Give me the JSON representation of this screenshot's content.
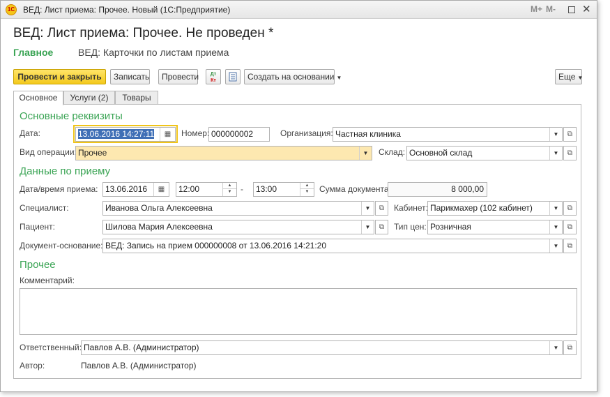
{
  "window": {
    "title": "ВЕД: Лист приема: Прочее. Новый  (1С:Предприятие)",
    "icon": "1c-icon",
    "controls": {
      "mplus": "M+",
      "mminus": "M-",
      "maximize": "maximize-icon",
      "close": "✕"
    }
  },
  "header": {
    "title": "ВЕД: Лист приема: Прочее. Не проведен *",
    "nav_main": "Главное",
    "nav_link": "ВЕД: Карточки по листам приема"
  },
  "toolbar": {
    "post_close": "Провести и закрыть",
    "save": "Записать",
    "post": "Провести",
    "dtkt_icon": "Дт Кт",
    "doc_icon": "document-icon",
    "create_based": "Создать на основании",
    "more": "Еще"
  },
  "tabs": [
    {
      "label": "Основное",
      "active": true
    },
    {
      "label": "Услуги (2)",
      "active": false
    },
    {
      "label": "Товары",
      "active": false
    }
  ],
  "main_req": {
    "section": "Основные реквизиты",
    "date_label": "Дата:",
    "date_value": "13.06.2016 14:27:11",
    "number_label": "Номер:",
    "number_value": "000000002",
    "org_label": "Организация:",
    "org_value": "Частная клиника",
    "op_label": "Вид операции:",
    "op_value": "Прочее",
    "stock_label": "Склад:",
    "stock_value": "Основной склад"
  },
  "reception": {
    "section": "Данные по приему",
    "dt_label": "Дата/время приема:",
    "date": "13.06.2016",
    "time_from": "12:00",
    "dash": "-",
    "time_to": "13:00",
    "sum_label": "Сумма документа:",
    "sum_value": "8 000,00",
    "spec_label": "Специалист:",
    "spec_value": "Иванова Ольга Алексеевна",
    "cab_label": "Кабинет:",
    "cab_value": "Парикмахер (102 кабинет)",
    "patient_label": "Пациент:",
    "patient_value": "Шилова Мария Алексеевна",
    "price_label": "Тип цен:",
    "price_value": "Розничная",
    "basis_label": "Документ-основание:",
    "basis_value": "ВЕД: Запись на прием 000000008 от 13.06.2016 14:21:20"
  },
  "other": {
    "section": "Прочее",
    "comment_label": "Комментарий:",
    "comment_value": "",
    "resp_label": "Ответственный:",
    "resp_value": "Павлов А.В. (Администратор)",
    "author_label": "Автор:",
    "author_value": "Павлов А.В. (Администратор)"
  },
  "colors": {
    "accent_green": "#3aa454",
    "primary_button": "#f3c91c",
    "focus": "#f0c419",
    "highlight_field": "#fde8b0"
  }
}
